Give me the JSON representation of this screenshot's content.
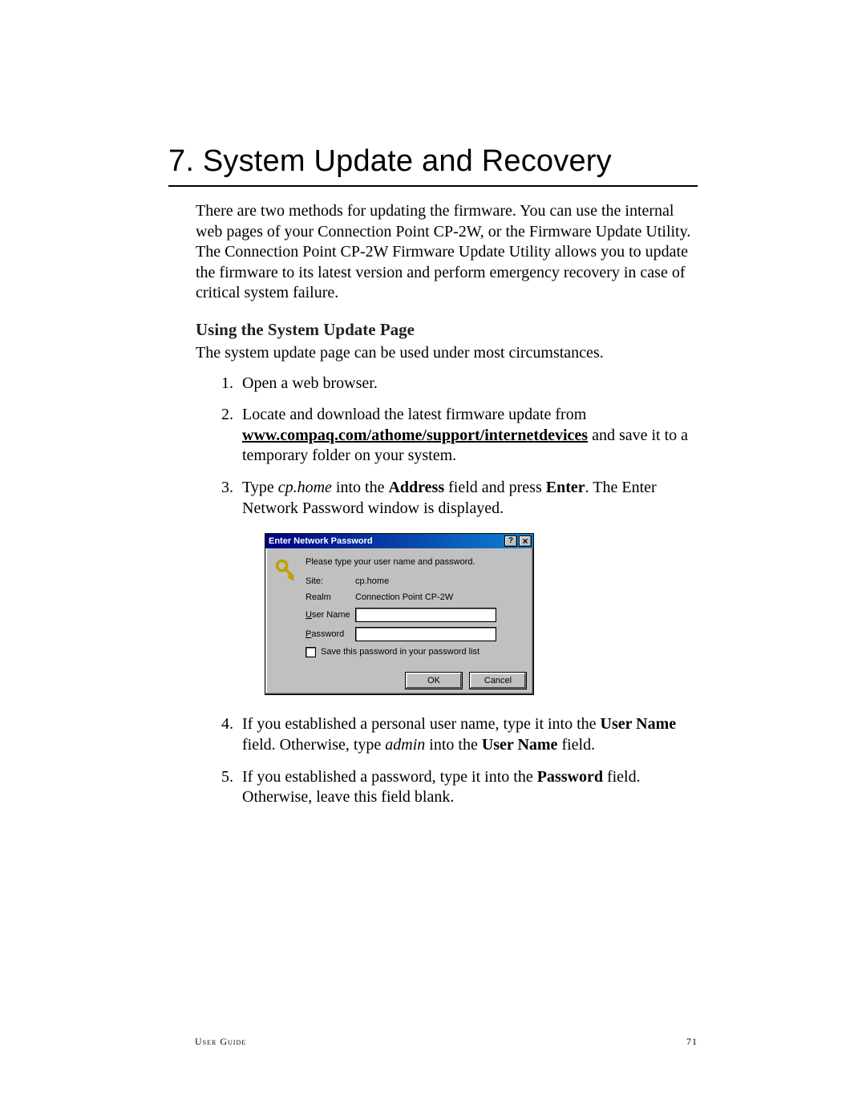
{
  "chapter_title": "7. System Update and Recovery",
  "intro_paragraph": "There are two methods for updating the firmware. You can use the internal web pages of your Connection Point CP-2W, or the Firmware Update Utility. The Connection Point CP-2W Firmware Update Utility allows you to update the firmware to its latest version and perform emergency recovery in case of critical system failure.",
  "section_title": "Using the System Update Page",
  "section_intro": "The system update page can be used under most circumstances.",
  "steps": {
    "s1": "Open a web browser.",
    "s2_pre": "Locate and download the latest firmware update from ",
    "s2_link": "www.compaq.com/athome/support/internetdevices",
    "s2_post": " and save it to a temporary folder on your system.",
    "s3_a": "Type ",
    "s3_em": "cp.home",
    "s3_b": " into the ",
    "s3_bold1": "Address",
    "s3_c": " field and press ",
    "s3_bold2": "Enter",
    "s3_d": ". The Enter Network Password window is displayed.",
    "s4_a": "If you established a personal user name, type it into the ",
    "s4_bold1": "User Name",
    "s4_b": " field. Otherwise, type ",
    "s4_em": "admin",
    "s4_c": " into the ",
    "s4_bold2": "User Name",
    "s4_d": " field.",
    "s5_a": "If you established a password, type it into the ",
    "s5_bold": "Password",
    "s5_b": " field. Otherwise, leave this field blank."
  },
  "dialog": {
    "title": "Enter Network Password",
    "help_btn": "?",
    "close_btn": "×",
    "prompt": "Please type your user name and password.",
    "site_label": "Site:",
    "site_value": "cp.home",
    "realm_label": "Realm",
    "realm_value": "Connection Point CP-2W",
    "username_label_pre": "U",
    "username_label_post": "ser Name",
    "username_value": "",
    "password_label_pre": "P",
    "password_label_post": "assword",
    "password_value": "",
    "save_pre": "S",
    "save_post": "ave this password in your password list",
    "ok_btn": "OK",
    "cancel_btn": "Cancel"
  },
  "footer": {
    "label": "User Guide",
    "page": "71"
  }
}
